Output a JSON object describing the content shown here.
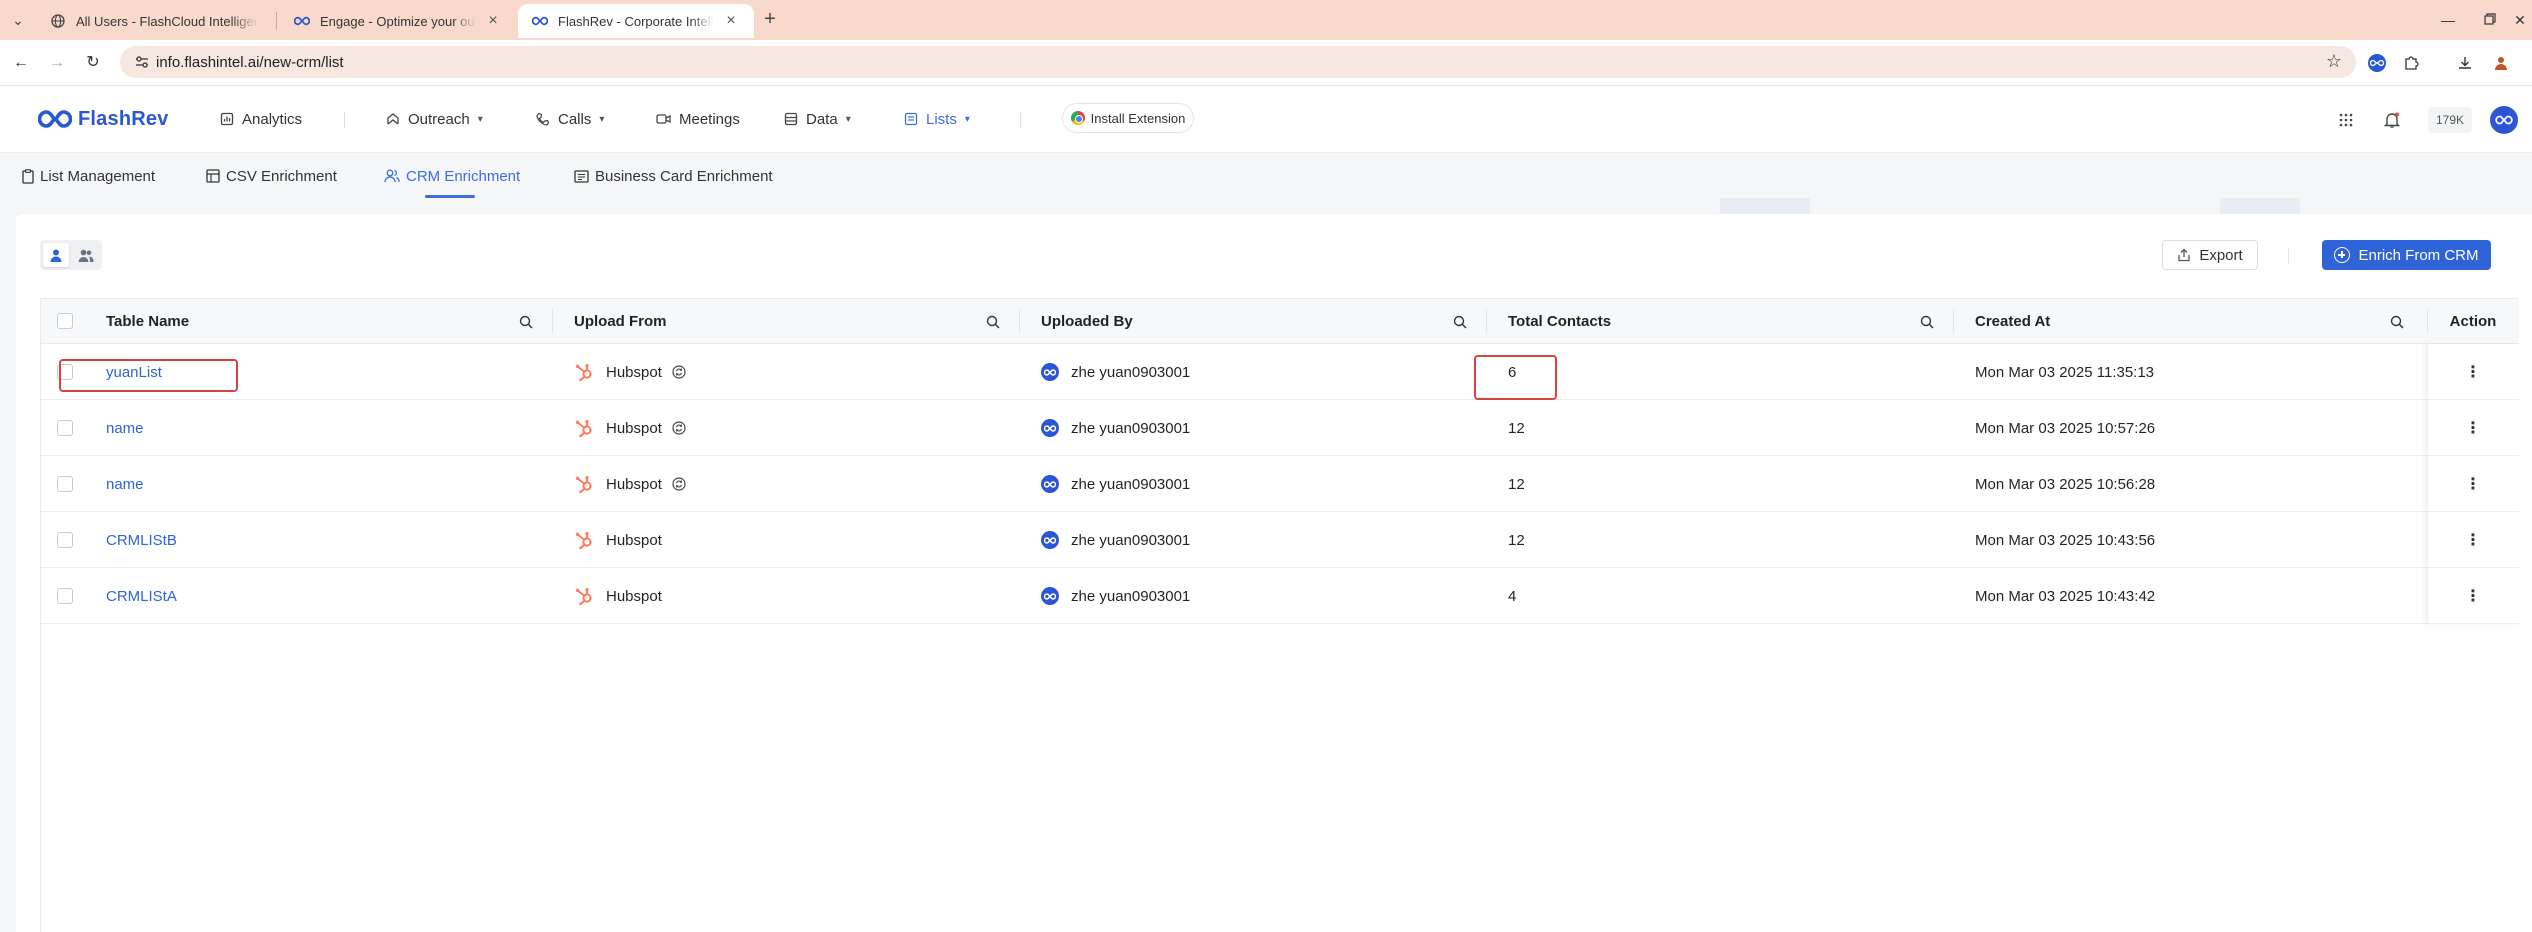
{
  "browser": {
    "tabs": [
      {
        "title": "All Users - FlashCloud Intelligence"
      },
      {
        "title": "Engage - Optimize your outreach"
      },
      {
        "title": "FlashRev - Corporate Intelligence"
      }
    ],
    "url": "info.flashintel.ai/new-crm/list"
  },
  "header": {
    "brand": "FlashRev",
    "nav": [
      {
        "label": "Analytics"
      },
      {
        "label": "Outreach"
      },
      {
        "label": "Calls"
      },
      {
        "label": "Meetings"
      },
      {
        "label": "Data"
      },
      {
        "label": "Lists"
      }
    ],
    "install_extension": "Install Extension",
    "credits": "179K"
  },
  "subnav": {
    "tabs": [
      {
        "label": "List Management"
      },
      {
        "label": "CSV Enrichment"
      },
      {
        "label": "CRM Enrichment"
      },
      {
        "label": "Business Card Enrichment"
      }
    ]
  },
  "toolbar": {
    "export_label": "Export",
    "enrich_label": "Enrich From CRM"
  },
  "table": {
    "columns": [
      "Table Name",
      "Upload From",
      "Uploaded By",
      "Total Contacts",
      "Created At",
      "Action"
    ],
    "rows": [
      {
        "name": "yuanList",
        "source": "Hubspot",
        "synced": true,
        "uploaded_by": "zhe yuan0903001",
        "total": "6",
        "created": "Mon Mar 03 2025 11:35:13"
      },
      {
        "name": "name",
        "source": "Hubspot",
        "synced": true,
        "uploaded_by": "zhe yuan0903001",
        "total": "12",
        "created": "Mon Mar 03 2025 10:57:26"
      },
      {
        "name": "name",
        "source": "Hubspot",
        "synced": true,
        "uploaded_by": "zhe yuan0903001",
        "total": "12",
        "created": "Mon Mar 03 2025 10:56:28"
      },
      {
        "name": "CRMLIStB",
        "source": "Hubspot",
        "synced": false,
        "uploaded_by": "zhe yuan0903001",
        "total": "12",
        "created": "Mon Mar 03 2025 10:43:56"
      },
      {
        "name": "CRMLIStA",
        "source": "Hubspot",
        "synced": false,
        "uploaded_by": "zhe yuan0903001",
        "total": "4",
        "created": "Mon Mar 03 2025 10:43:42"
      }
    ]
  },
  "colors": {
    "accent": "#2f63d8",
    "brand": "#2b56d6",
    "tabstrip": "#f9d9cb",
    "hubspot": "#ff7a59",
    "highlight": "#d9433b"
  }
}
